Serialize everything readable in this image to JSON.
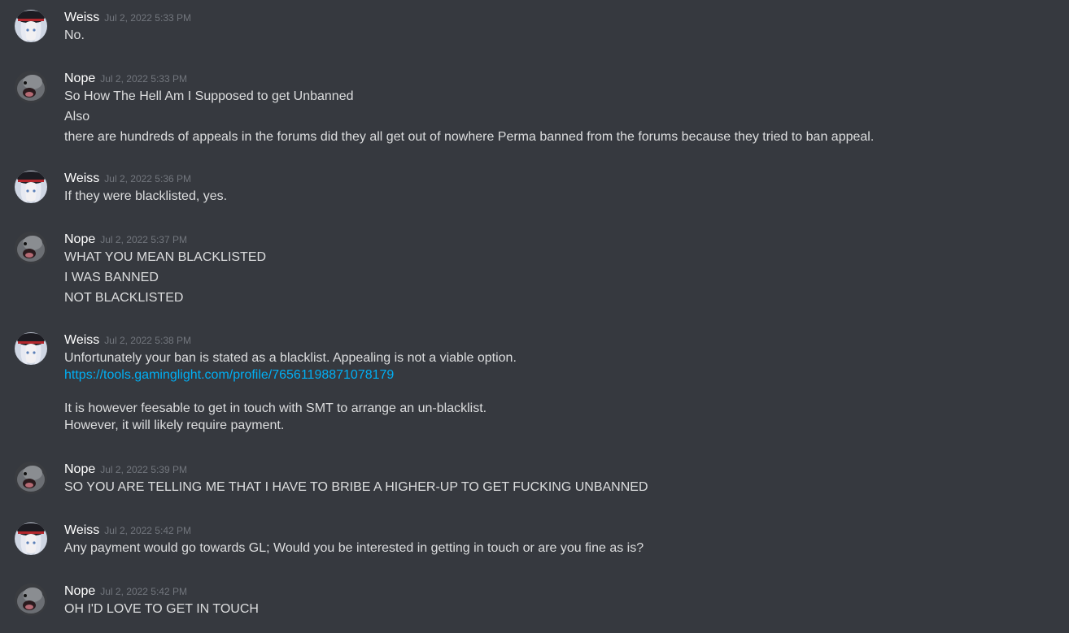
{
  "colors": {
    "background": "#36393f",
    "author": "#ffffff",
    "timestamp": "#72767d",
    "text": "#dcddde",
    "link": "#00aff4"
  },
  "messages": [
    {
      "author": "Weiss",
      "avatar": "weiss-avatar",
      "timestamp": "Jul 2, 2022 5:33 PM",
      "lines": [
        "No."
      ]
    },
    {
      "author": "Nope",
      "avatar": "nope-avatar",
      "timestamp": "Jul 2, 2022 5:33 PM",
      "lines": [
        "So How The Hell Am I Supposed to get Unbanned",
        "Also",
        "there are hundreds of appeals in the forums did they all get out of nowhere Perma banned from the forums because they tried to ban appeal."
      ]
    },
    {
      "author": "Weiss",
      "avatar": "weiss-avatar",
      "timestamp": "Jul 2, 2022 5:36 PM",
      "lines": [
        "If they were blacklisted, yes."
      ]
    },
    {
      "author": "Nope",
      "avatar": "nope-avatar",
      "timestamp": "Jul 2, 2022 5:37 PM",
      "lines": [
        "WHAT YOU MEAN BLACKLISTED",
        "I WAS BANNED",
        "NOT BLACKLISTED"
      ]
    },
    {
      "author": "Weiss",
      "avatar": "weiss-avatar",
      "timestamp": "Jul 2, 2022 5:38 PM",
      "text_1": "Unfortunately your ban is stated as a blacklist. Appealing is not a viable option.",
      "link": "https://tools.gaminglight.com/profile/76561198871078179",
      "text_2": "It is however feesable to get in touch with SMT to arrange an un-blacklist.",
      "text_3": "However, it will likely require payment."
    },
    {
      "author": "Nope",
      "avatar": "nope-avatar",
      "timestamp": "Jul 2, 2022 5:39 PM",
      "lines": [
        "SO YOU ARE TELLING ME THAT I HAVE TO BRIBE A HIGHER-UP TO GET FUCKING UNBANNED"
      ]
    },
    {
      "author": "Weiss",
      "avatar": "weiss-avatar",
      "timestamp": "Jul 2, 2022 5:42 PM",
      "lines": [
        "Any payment would go towards GL; Would you be interested in getting in touch or are you fine as is?"
      ]
    },
    {
      "author": "Nope",
      "avatar": "nope-avatar",
      "timestamp": "Jul 2, 2022 5:42 PM",
      "lines": [
        "OH I'D LOVE TO GET IN TOUCH"
      ]
    }
  ]
}
